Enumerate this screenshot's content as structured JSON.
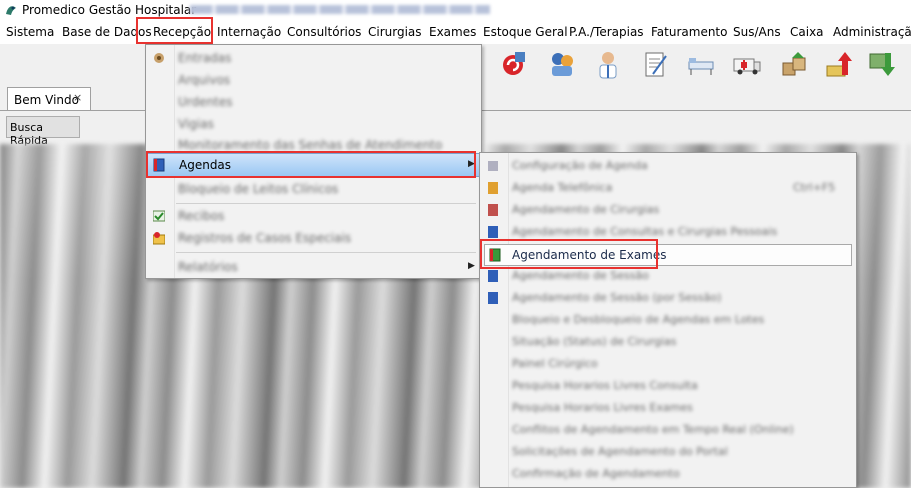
{
  "title_bar": {
    "app_title": "Promedico Gestão Hospitalar -"
  },
  "menu_bar": {
    "items": [
      "Sistema",
      "Base de Dados",
      "Recepção",
      "Internação",
      "Consultórios",
      "Cirurgias",
      "Exames",
      "Estoque Geral",
      "P.A./Terapias",
      "Faturamento",
      "Sus/Ans",
      "Caixa",
      "Administração"
    ]
  },
  "tabs": {
    "active": "Bem Vindo",
    "close_glyph": "×"
  },
  "quick_search": {
    "label": "Busca Rápida"
  },
  "recepcao_menu": {
    "items": [
      "Entradas",
      "Arquivos",
      "Urdentes",
      "Vigias",
      "Monitoramento das Senhas de Atendimento",
      "Agendas",
      "Bloqueio de Leitos Clínicos",
      "Recibos",
      "Registros de Casos Especiais",
      "Relatórios"
    ],
    "highlighted": "Agendas"
  },
  "agendas_submenu": {
    "items": [
      "Configuração de Agenda",
      "Agenda Telefônica",
      "Agendamento de Cirurgias",
      "Agendamento de Consultas e Cirurgias Pessoais",
      "Agendamento de Exames",
      "Agendamento de Sessão",
      "Agendamento de Sessão (por Sessão)",
      "Bloqueio e Desbloqueio de Agendas em Lotes",
      "Situação (Status) de Cirurgias",
      "Painel Cirúrgico",
      "Pesquisa Horarios Livres Consulta",
      "Pesquisa Horarios Livres Exames",
      "Conflitos de Agendamento em Tempo Real (Online)",
      "Solicitações de Agendamento do Portal",
      "Confirmação de Agendamento"
    ],
    "shortcut": "Ctrl+F5",
    "highlighted": "Agendamento de Exames"
  },
  "colors": {
    "annotation": "#e8322f",
    "selection": "#9ac7f3"
  }
}
